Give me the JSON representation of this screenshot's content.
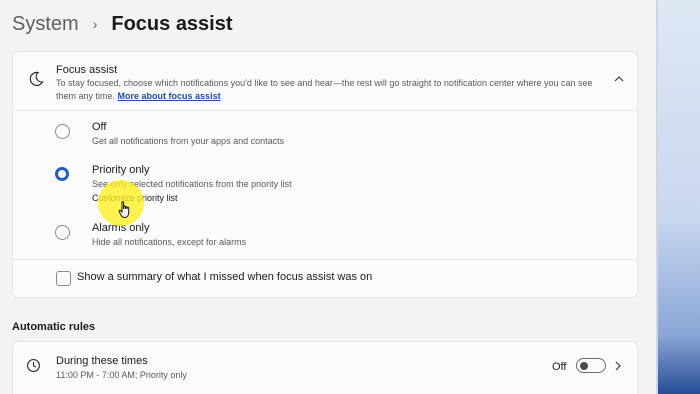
{
  "breadcrumb": {
    "parent": "System",
    "separator": "›",
    "current": "Focus assist"
  },
  "focus_assist": {
    "title": "Focus assist",
    "description": "To stay focused, choose which notifications you'd like to see and hear—the rest will go straight to notification center where you can see them any time.",
    "link": "More about focus assist",
    "icon": "moon-icon",
    "expanded": true
  },
  "options": [
    {
      "title": "Off",
      "subtitle": "Get all notifications from your apps and contacts",
      "selected": false
    },
    {
      "title": "Priority only",
      "subtitle": "See only selected notifications from the priority list",
      "link": "Customize priority list",
      "selected": true
    },
    {
      "title": "Alarms only",
      "subtitle": "Hide all notifications, except for alarms",
      "selected": false
    }
  ],
  "summary_checkbox": {
    "label": "Show a summary of what I missed when focus assist was on",
    "checked": false
  },
  "automatic_rules": {
    "section_title": "Automatic rules",
    "items": [
      {
        "title": "During these times",
        "subtitle": "11:00 PM - 7:00 AM; Priority only",
        "state": "Off",
        "icon": "clock-icon"
      }
    ]
  },
  "colors": {
    "accent": "#1f5fbf",
    "link": "#1f4ea3",
    "cursor_highlight": "#fff01e"
  }
}
